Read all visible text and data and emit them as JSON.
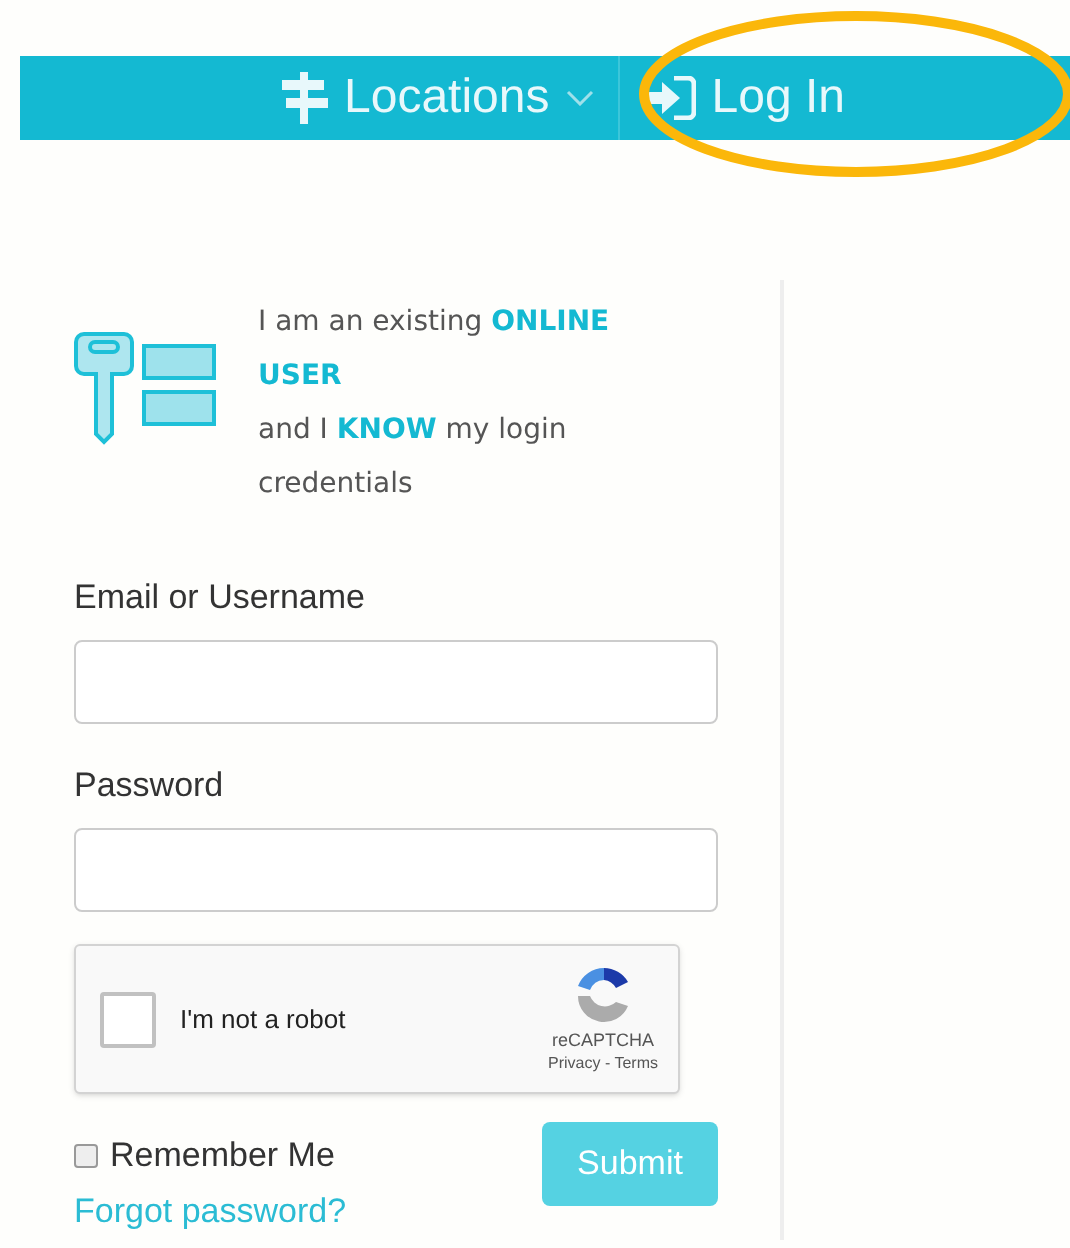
{
  "nav": {
    "items": [
      {
        "kind": "dropdown",
        "label": "Locations"
      },
      {
        "kind": "login",
        "label": "Log In"
      }
    ]
  },
  "intro": [
    "I am an existing **ONLINE USER**",
    "and I **KNOW** my login credentials"
  ],
  "fields": [
    {
      "label": "Email or Username"
    },
    {
      "label": "Password"
    }
  ],
  "captcha": {
    "label": "I'm not a robot",
    "checked": false,
    "brand": "reCAPTCHA",
    "links": "Privacy - Terms"
  },
  "remember": {
    "label": "Remember Me",
    "checked": false
  },
  "submit": "Submit",
  "forgot": "Forgot password?"
}
